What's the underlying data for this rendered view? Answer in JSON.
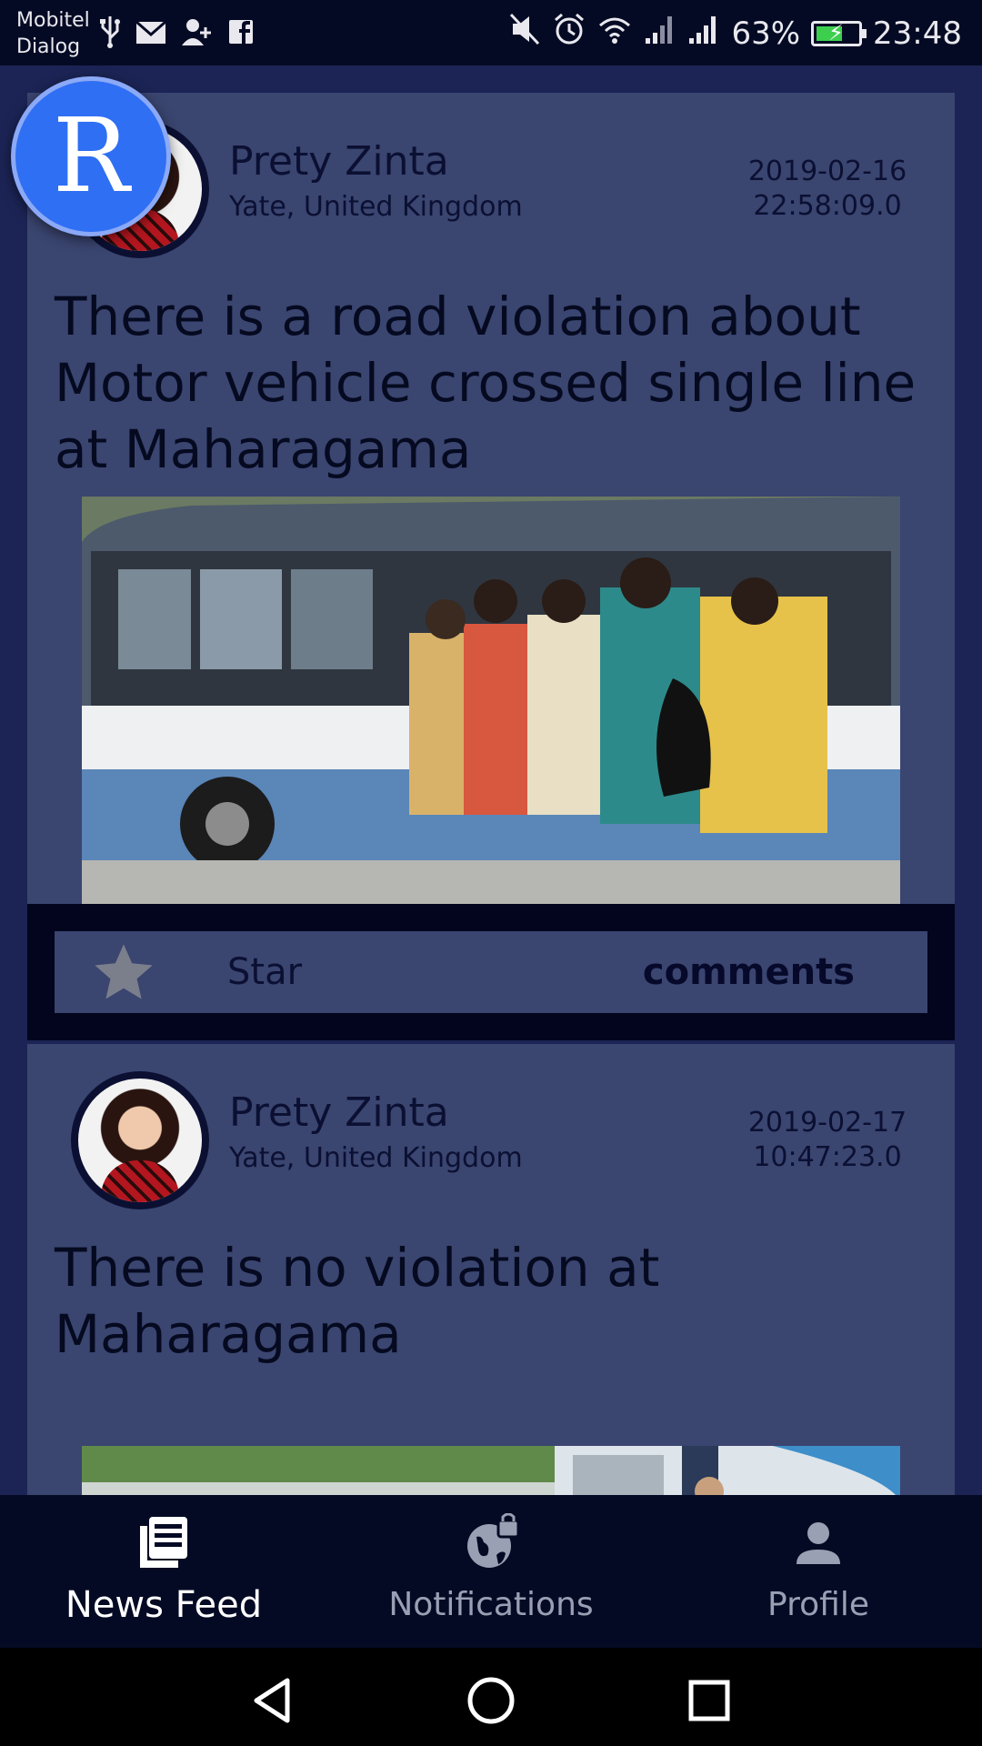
{
  "status_bar": {
    "carrier_1": "Mobitel",
    "carrier_2": "Dialog",
    "notification_icons": [
      "usb-icon",
      "mail-icon",
      "add-contact-icon",
      "facebook-icon"
    ],
    "system_icons": [
      "mute-icon",
      "alarm-icon",
      "wifi-icon",
      "signal-icon",
      "signal-icon"
    ],
    "battery": "63%",
    "battery_level": 0.63,
    "time": "23:48"
  },
  "floating_badge": {
    "letter": "R",
    "color": "#2f6ff3"
  },
  "posts": [
    {
      "author": "Prety Zinta",
      "location": "Yate, United Kingdom",
      "date": "2019-02-16",
      "time": "22:58:09.0",
      "text": "There is a road violation about Motor vehicle crossed single line at Maharagama",
      "image": "crowded-bus-photo",
      "star_label": "Star",
      "comments_label": "comments"
    },
    {
      "author": "Prety Zinta",
      "location": "Yate, United Kingdom",
      "date": "2019-02-17",
      "time": "10:47:23.0",
      "text": "There is no violation at Maharagama",
      "image": "street-bus-photo"
    }
  ],
  "bottom_nav": {
    "items": [
      {
        "label": "News Feed",
        "icon": "news-feed-icon",
        "active": true
      },
      {
        "label": "Notifications",
        "icon": "globe-lock-icon",
        "active": false
      },
      {
        "label": "Profile",
        "icon": "person-icon",
        "active": false
      }
    ]
  },
  "colors": {
    "background": "#0b1033",
    "card": "#3a4570",
    "bottom_nav": "#050a24",
    "badge": "#2f6ff3",
    "star": "#7b7f8c"
  }
}
